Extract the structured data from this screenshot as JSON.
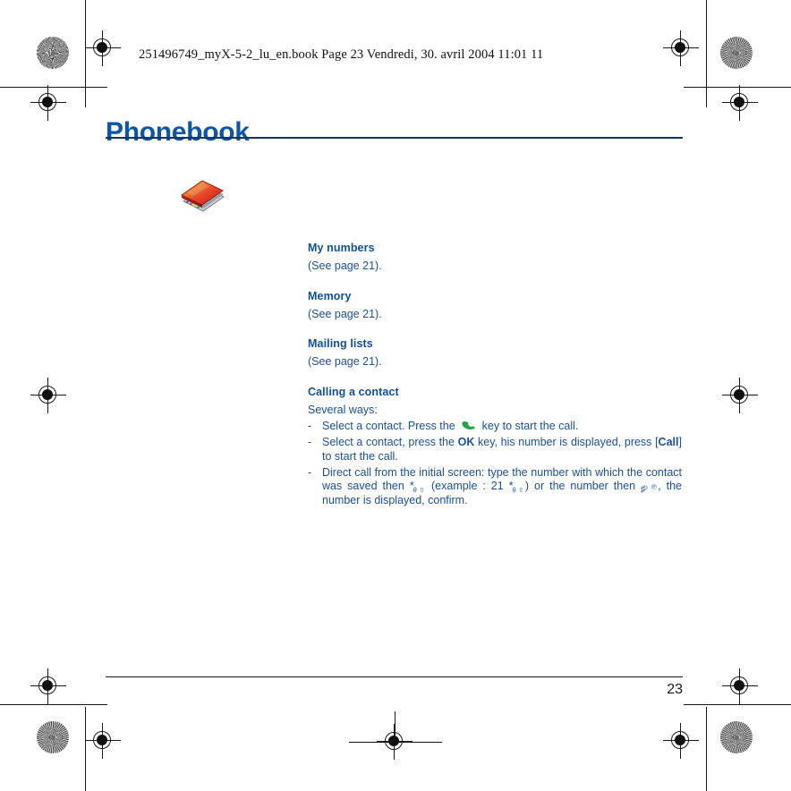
{
  "document": {
    "header_line": "251496749_myX-5-2_lu_en.book  Page 23  Vendredi, 30. avril 2004  11:01 11",
    "chapter_title": "Phonebook",
    "page_number": "23",
    "accent_color": "#0d56a6",
    "body_color": "#1a4f9c",
    "call_key_color": "#2aa14a",
    "icon_name": "address-book-icon"
  },
  "sections": [
    {
      "heading": "My numbers",
      "body": "(See page 21)."
    },
    {
      "heading": "Memory",
      "body": "(See page 21)."
    },
    {
      "heading": "Mailing lists",
      "body": "(See page 21)."
    }
  ],
  "calling": {
    "heading": "Calling a contact",
    "lead": "Several ways:",
    "bullets": [
      {
        "dash": "-",
        "part1": "Select a contact. Press the",
        "icon": "green-call-key-icon",
        "part2": "key to start the call."
      },
      {
        "dash": "-",
        "part1": "Select a contact, press the",
        "bold1": "OK",
        "part2": "key, his number is displayed, press [",
        "bold2": "Call",
        "part3": "] to start the call."
      },
      {
        "dash": "-",
        "part1": "Direct call from the initial screen: type the number with which the contact was saved then",
        "star_glyph": "*",
        "star_sub": "θ ⇧",
        "part2": "(example : 21",
        "star_glyph2": "*",
        "star_sub2": "θ ⇧",
        "part3": ") or the number then",
        "hash_glyph": "♯",
        "hash_sub": "♪ ℗",
        "part4": ", the number is displayed, confirm."
      }
    ]
  }
}
